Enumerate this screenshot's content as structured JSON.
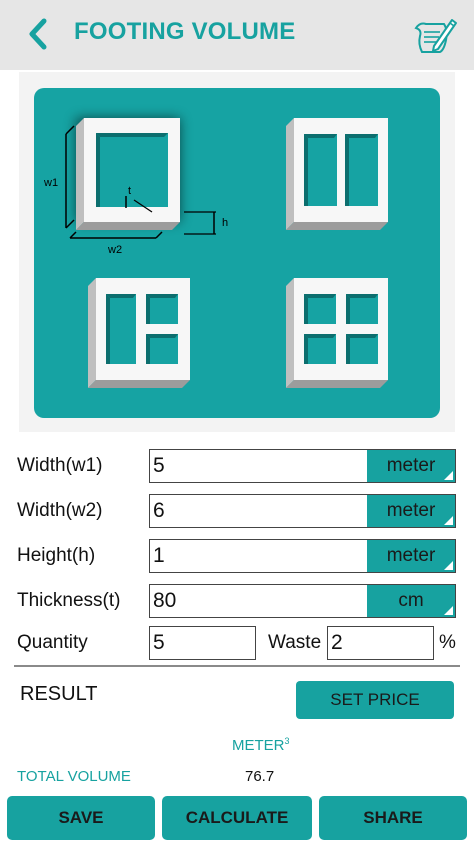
{
  "header": {
    "title": "FOOTING VOLUME",
    "back_icon": "chevron-left-icon",
    "note_icon": "notepad-pen-icon"
  },
  "diagram": {
    "labels": {
      "w1": "w1",
      "w2": "w2",
      "h": "h",
      "t": "t"
    }
  },
  "fields": [
    {
      "label": "Width(w1)",
      "value": "5",
      "unit": "meter"
    },
    {
      "label": "Width(w2)",
      "value": "6",
      "unit": "meter"
    },
    {
      "label": "Height(h)",
      "value": "1",
      "unit": "meter"
    },
    {
      "label": "Thickness(t)",
      "value": "80",
      "unit": "cm"
    }
  ],
  "quantity": {
    "label": "Quantity",
    "value": "5"
  },
  "waste": {
    "label": "Waste",
    "value": "2",
    "suffix": "%"
  },
  "result": {
    "label": "RESULT",
    "set_price_label": "SET PRICE",
    "unit_label": "METER",
    "unit_sup": "3",
    "total_label": "TOTAL VOLUME",
    "total_value": "76.7"
  },
  "buttons": {
    "save": "SAVE",
    "calculate": "CALCULATE",
    "share": "SHARE"
  },
  "colors": {
    "accent": "#17a2a0",
    "header_bg": "#e6e6e6"
  }
}
